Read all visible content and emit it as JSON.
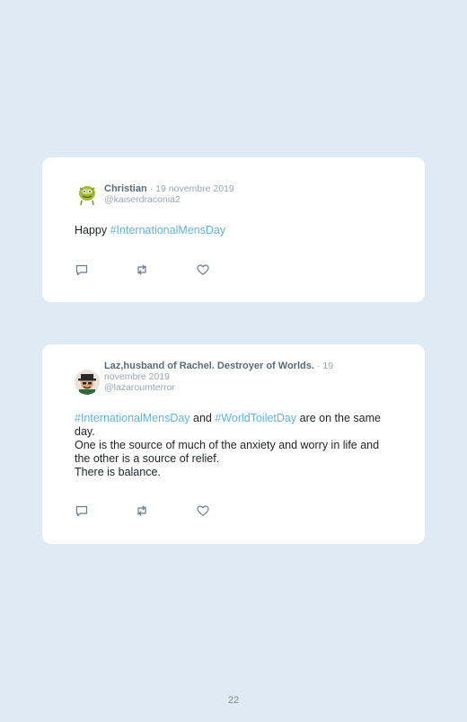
{
  "tweets": [
    {
      "name": "Christian",
      "date": "· 19 novembre 2019",
      "handle": "@kaiserdraconia2",
      "text_parts": {
        "p1": "Happy ",
        "tag1": "#InternationalMensDay"
      },
      "avatar": "green-creature-avatar",
      "actions": [
        "reply-icon",
        "retweet-icon",
        "like-icon"
      ]
    },
    {
      "name": "Laz,husband of Rachel. Destroyer of Worlds.",
      "date_line1": "· 19",
      "date_line2": "novembre 2019",
      "handle": "@lazaroumterror",
      "text_parts": {
        "tag1": "#InternationalMensDay",
        "p2": " and ",
        "tag2": "#WorldToiletDay",
        "p3": " are on the same day.",
        "line2": "One is the source of much of the anxiety and worry in life and the other is a source of relief.",
        "line3": "There is balance."
      },
      "avatar": "man-with-hat-avatar",
      "actions": [
        "reply-icon",
        "retweet-icon",
        "like-icon"
      ]
    }
  ],
  "page_number": "22",
  "colors": {
    "background": "#deebf4",
    "card": "#ffffff",
    "hashtag": "#5eb6de",
    "name": "#5c6b78",
    "meta": "#9aa6b0"
  }
}
